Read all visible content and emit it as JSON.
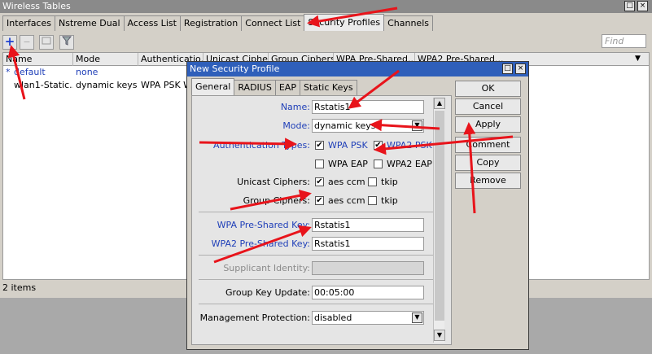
{
  "window": {
    "title": "Wireless Tables"
  },
  "tabs": [
    "Interfaces",
    "Nstreme Dual",
    "Access List",
    "Registration",
    "Connect List",
    "Security Profiles",
    "Channels"
  ],
  "toolbar": {
    "find_placeholder": "Find"
  },
  "grid": {
    "columns": [
      "Name",
      "Mode",
      "Authenticatio...",
      "Unicast Ciphers",
      "Group Ciphers",
      "WPA Pre-Shared...",
      "WPA2 Pre-Shared..."
    ],
    "rows": [
      {
        "marker": "*",
        "name": "default",
        "mode": "none",
        "auth": ""
      },
      {
        "marker": "",
        "name": "wlan1-Static...",
        "mode": "dynamic keys",
        "auth": "WPA PSK W"
      }
    ]
  },
  "status": "2 items",
  "dialog": {
    "title": "New Security Profile",
    "tabs": [
      "General",
      "RADIUS",
      "EAP",
      "Static Keys"
    ],
    "name_label": "Name:",
    "name_value": "Rstatis1",
    "mode_label": "Mode:",
    "mode_value": "dynamic keys",
    "auth_label": "Authentication Types:",
    "auth_wpa_psk": "WPA PSK",
    "auth_wpa2_psk": "WPA2 PSK",
    "auth_wpa_eap": "WPA EAP",
    "auth_wpa2_eap": "WPA2 EAP",
    "unicast_label": "Unicast Ciphers:",
    "group_label": "Group Ciphers:",
    "aes_ccm": "aes ccm",
    "tkip": "tkip",
    "wpa_key_label": "WPA Pre-Shared Key:",
    "wpa_key_value": "Rstatis1",
    "wpa2_key_label": "WPA2 Pre-Shared Key:",
    "wpa2_key_value": "Rstatis1",
    "supplicant_label": "Supplicant Identity:",
    "group_update_label": "Group Key Update:",
    "group_update_value": "00:05:00",
    "mgmt_label": "Management Protection:",
    "mgmt_value": "disabled",
    "buttons": {
      "ok": "OK",
      "cancel": "Cancel",
      "apply": "Apply",
      "comment": "Comment",
      "copy": "Copy",
      "remove": "Remove"
    }
  },
  "colors": {
    "annotation_arrow": "#e8141b",
    "dialog_titlebar": "#2f5fba",
    "link_blue": "#1f3fb8"
  }
}
